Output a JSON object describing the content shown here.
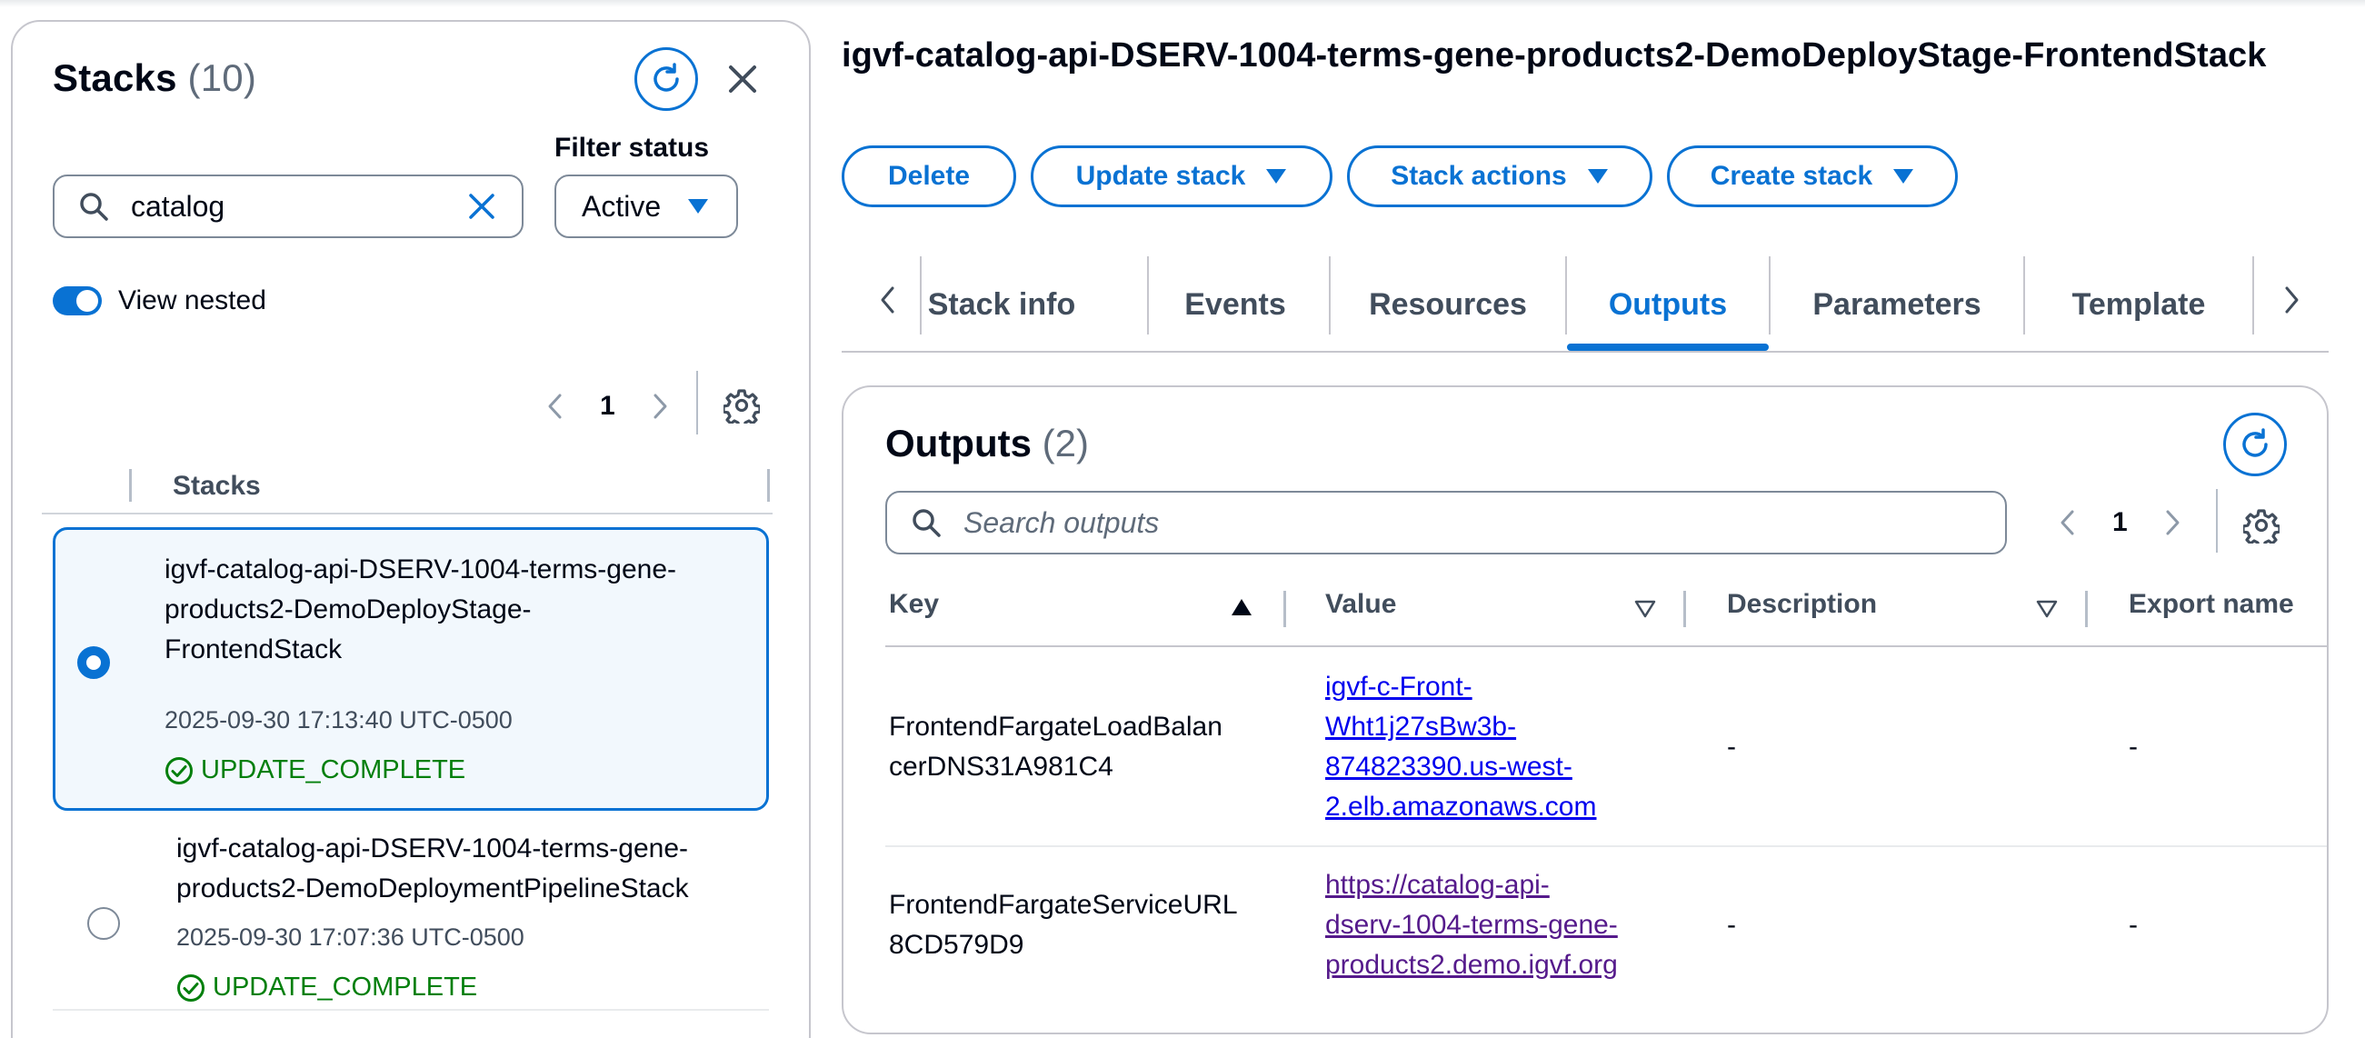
{
  "left_panel": {
    "title": "Stacks",
    "count": "(10)",
    "filter_label": "Filter status",
    "search_value": "catalog",
    "filter_value": "Active",
    "view_nested_label": "View nested",
    "view_nested_on": true,
    "page": "1",
    "column_header": "Stacks",
    "stacks": [
      {
        "name_lines": [
          "igvf-catalog-api-DSERV-1004-terms-gene-",
          "products2-DemoDeployStage-",
          "FrontendStack"
        ],
        "date": "2025-09-30 17:13:40 UTC-0500",
        "status": "UPDATE_COMPLETE",
        "selected": true
      },
      {
        "name_lines": [
          "igvf-catalog-api-DSERV-1004-terms-gene-",
          "products2-DemoDeploymentPipelineStack"
        ],
        "date": "2025-09-30 17:07:36 UTC-0500",
        "status": "UPDATE_COMPLETE",
        "selected": false
      }
    ]
  },
  "main": {
    "title": "igvf-catalog-api-DSERV-1004-terms-gene-products2-DemoDeployStage-FrontendStack",
    "actions": {
      "delete": "Delete",
      "update": "Update stack",
      "stack_actions": "Stack actions",
      "create": "Create stack"
    },
    "tabs": [
      "Stack info",
      "Events",
      "Resources",
      "Outputs",
      "Parameters",
      "Template"
    ],
    "active_tab": "Outputs",
    "outputs": {
      "title": "Outputs",
      "count": "(2)",
      "search_placeholder": "Search outputs",
      "page": "1",
      "columns": {
        "key": "Key",
        "value": "Value",
        "description": "Description",
        "export": "Export name"
      },
      "rows": [
        {
          "key_lines": [
            "FrontendFargateLoadBalan",
            "cerDNS31A981C4"
          ],
          "value_lines": [
            "igvf-c-Front-",
            "Wht1j27sBw3b-",
            "874823390.us-west-",
            "2.elb.amazonaws.com"
          ],
          "description": "-",
          "export": "-"
        },
        {
          "key_lines": [
            "FrontendFargateServiceURL",
            "8CD579D9"
          ],
          "value_lines": [
            "https://catalog-api-",
            "dserv-1004-terms-gene-",
            "products2.demo.igvf.org"
          ],
          "description": "-",
          "export": "-"
        }
      ]
    }
  },
  "colors": {
    "accent": "#0972d3",
    "success": "#037f0c",
    "border": "#c6c6cd",
    "selected_bg": "#f2f8fd"
  }
}
